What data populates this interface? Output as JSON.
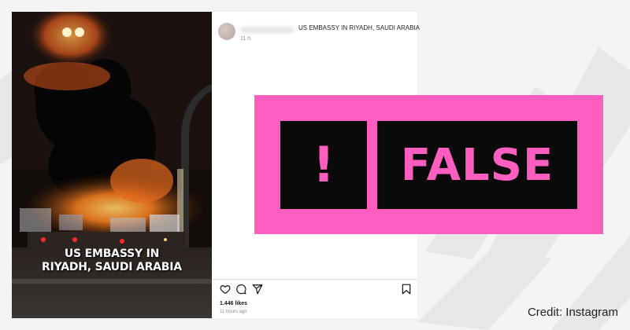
{
  "post": {
    "caption": "US EMBASSY IN RIYADH, SAUDI ARABIA",
    "time_short": "11 h",
    "video_caption_line1": "US EMBASSY IN",
    "video_caption_line2": "RIYADH, SAUDI ARABIA",
    "likes": "1.446 likes",
    "time_ago": "11 hours ago",
    "icons": [
      "heart-icon",
      "comment-icon",
      "share-icon",
      "bookmark-icon"
    ]
  },
  "verdict": {
    "mark": "!",
    "label": "FALSE",
    "colors": {
      "badge": "#ff5ec1",
      "box": "#0a0a0a"
    }
  },
  "credit": "Credit: Instagram"
}
